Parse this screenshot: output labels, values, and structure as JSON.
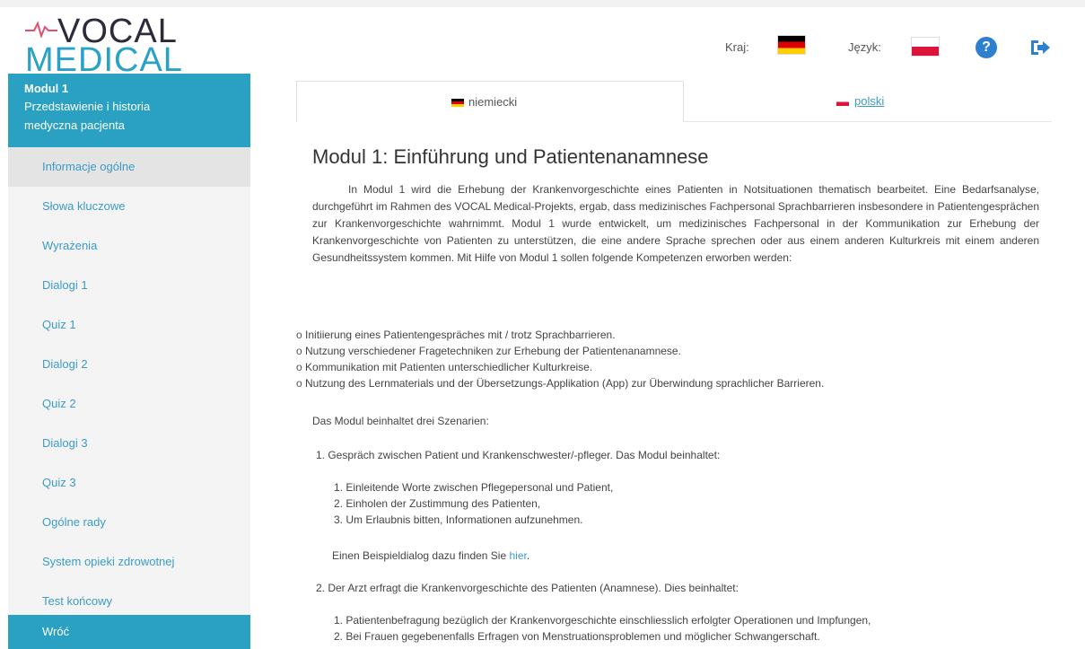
{
  "header": {
    "logo_top": "VOCAL",
    "logo_bottom": "MEDICAL",
    "country_label": "Kraj:",
    "language_label": "Język:",
    "help_icon": "question-circle-icon",
    "logout_icon": "sign-out-icon",
    "colors": {
      "accent": "#2aa0c2",
      "help": "#2d7fd0"
    }
  },
  "sidebar": {
    "module_title": "Modul 1",
    "module_subtitle": "Przedstawienie i historia medyczna pacjenta",
    "items": [
      {
        "label": "Informacje ogólne"
      },
      {
        "label": "Słowa kluczowe"
      },
      {
        "label": "Wyrażenia"
      },
      {
        "label": "Dialogi 1"
      },
      {
        "label": "Quiz 1"
      },
      {
        "label": "Dialogi 2"
      },
      {
        "label": "Quiz 2"
      },
      {
        "label": "Dialogi 3"
      },
      {
        "label": "Quiz 3"
      },
      {
        "label": "Ogólne rady"
      },
      {
        "label": "System opieki zdrowotnej"
      },
      {
        "label": "Test końcowy"
      }
    ],
    "back_label": "Wróć"
  },
  "tabs": [
    {
      "label": "niemiecki"
    },
    {
      "label": "polski"
    }
  ],
  "content": {
    "title": "Modul 1: Einführung und Patientenanamnese",
    "intro": "In Modul 1 wird die Erhebung der Krankenvorgeschichte eines Patienten in Notsituationen thematisch bearbeitet. Eine Bedarfsanalyse, durchgeführt im Rahmen des VOCAL Medical-Projekts, ergab, dass medizinisches Fachpersonal Sprachbarrieren insbesondere in Patientengesprächen zur Krankenvorgeschichte wahrnimmt. Modul 1 wurde entwickelt, um medizinisches Fachpersonal in der Kommunikation zur Erhebung der Krankenvorgeschichte von Patienten zu unterstützen, die eine andere Sprache sprechen oder aus einem anderen Kulturkreis mit einem anderen Gesundheitssystem kommen. Mit Hilfe von Modul 1 sollen folgende Kompetenzen erworben werden:",
    "bullets": [
      "Initiierung eines Patientengespräches mit / trotz Sprachbarrieren.",
      "Nutzung verschiedener Fragetechniken zur Erhebung der Patientenanamnese.",
      "Kommunikation mit Patienten unterschiedlicher Kulturkreise.",
      "Nutzung des Lernmaterials und der Übersetzungs-Applikation (App) zur Überwindung sprachlicher Barrieren."
    ],
    "scenarios_intro": "Das Modul beinhaltet drei Szenarien:",
    "s1_title": "1. Gespräch zwischen Patient und Krankenschwester/-pfleger. Das Modul beinhaltet:",
    "s1_items": [
      "1. Einleitende Worte zwischen Pflegepersonal und Patient,",
      "2. Einholen der Zustimmung des Patienten,",
      "3. Um Erlaubnis bitten, Informationen aufzunehmen."
    ],
    "example_text": "Einen Beispieldialog dazu finden Sie",
    "example_link": "hier",
    "s2_title": "2. Der Arzt erfragt die Krankenvorgeschichte des Patienten (Anamnese). Dies beinhaltet:",
    "s2_items": [
      "1. Patientenbefragung bezüglich der Krankenvorgeschichte einschliesslich erfolgter Operationen und Impfungen,",
      "2. Bei Frauen gegebenenfalls Erfragen von Menstruationsproblemen und möglicher Schwangerschaft."
    ]
  }
}
